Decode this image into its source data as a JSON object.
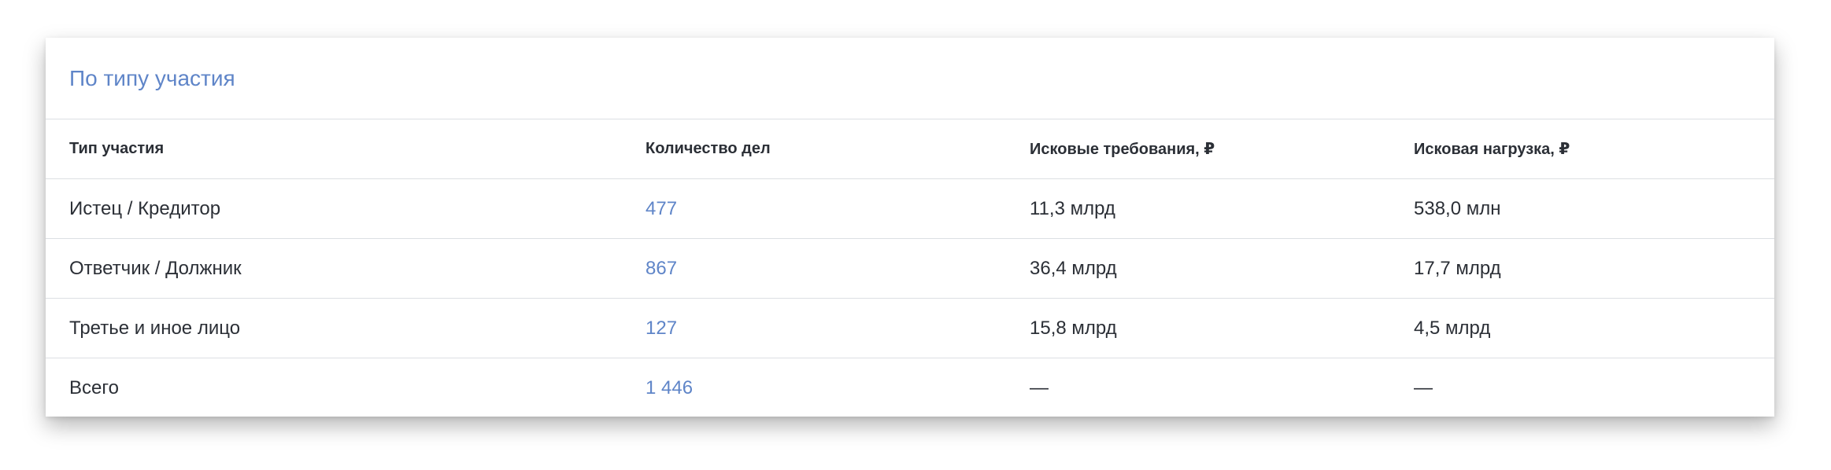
{
  "title": "По типу участия",
  "accent_color": "#5f85c8",
  "columns": [
    "Тип участия",
    "Количество дел",
    "Исковые требования, ₽",
    "Исковая нагрузка, ₽"
  ],
  "rows": [
    {
      "type": "Истец / Кредитор",
      "count": "477",
      "claims": "11,3 млрд",
      "load": "538,0 млн"
    },
    {
      "type": "Ответчик / Должник",
      "count": "867",
      "claims": "36,4 млрд",
      "load": "17,7 млрд"
    },
    {
      "type": "Третье и иное лицо",
      "count": "127",
      "claims": "15,8 млрд",
      "load": "4,5 млрд"
    },
    {
      "type": "Всего",
      "count": "1 446",
      "claims": "—",
      "load": "—"
    }
  ]
}
